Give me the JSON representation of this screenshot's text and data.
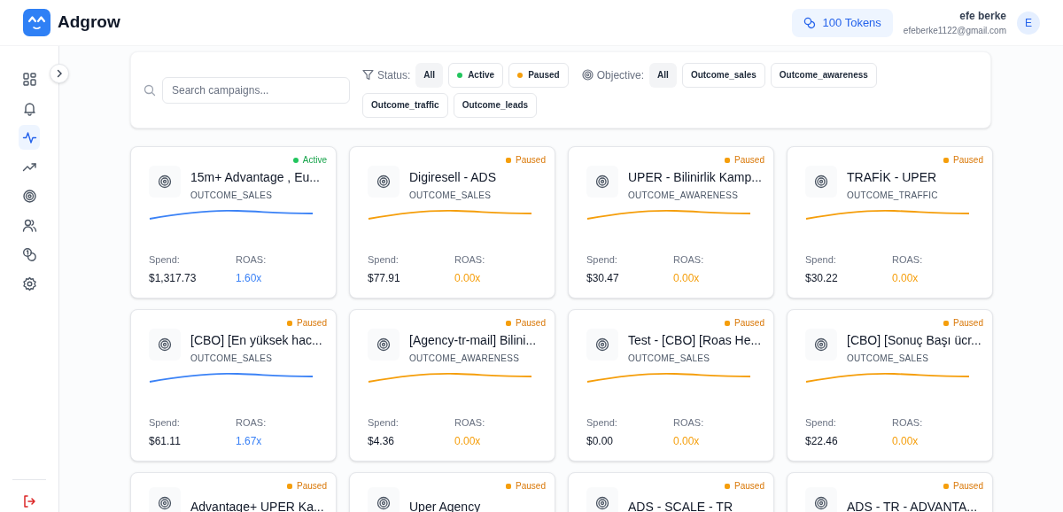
{
  "brand": {
    "name": "Adgrow"
  },
  "header": {
    "tokens": "100 Tokens",
    "user_name": "efe berke",
    "user_email": "efeberke1122@gmail.com",
    "avatar_initial": "E"
  },
  "sidebar": {
    "items": [
      {
        "kind": "dashboard",
        "selected": false
      },
      {
        "kind": "bell",
        "selected": false
      },
      {
        "kind": "activity",
        "selected": true
      },
      {
        "kind": "trending",
        "selected": false
      },
      {
        "kind": "target",
        "selected": false
      },
      {
        "kind": "users",
        "selected": false
      },
      {
        "kind": "coins",
        "selected": false
      },
      {
        "kind": "settings",
        "selected": false
      }
    ]
  },
  "filters": {
    "search_placeholder": "Search campaigns...",
    "status_label": "Status:",
    "status_options": [
      {
        "label": "All",
        "selected": true
      },
      {
        "label": "Active",
        "selected": false,
        "color": "#22c55e"
      },
      {
        "label": "Paused",
        "selected": false,
        "color": "#f59e0b"
      }
    ],
    "objective_label": "Objective:",
    "objective_options": [
      {
        "label": "All",
        "selected": true
      },
      {
        "label": "Outcome_sales",
        "selected": false
      },
      {
        "label": "Outcome_awareness",
        "selected": false
      },
      {
        "label": "Outcome_traffic",
        "selected": false
      },
      {
        "label": "Outcome_leads",
        "selected": false
      }
    ]
  },
  "campaigns": [
    {
      "title": "15m+ Advantage , Eu...",
      "objective": "OUTCOME_SALES",
      "status": "Active",
      "kind": "active",
      "spend_label": "Spend:",
      "spend": "$1,317.73",
      "roas_label": "ROAS:",
      "roas": "1.60x",
      "color": "#3b82f6"
    },
    {
      "title": "Digiresell - ADS",
      "objective": "OUTCOME_SALES",
      "status": "Paused",
      "kind": "paused",
      "spend_label": "Spend:",
      "spend": "$77.91",
      "roas_label": "ROAS:",
      "roas": "0.00x",
      "color": "#f59e0b"
    },
    {
      "title": "UPER - Bilinirlik Kamp...",
      "objective": "OUTCOME_AWARENESS",
      "status": "Paused",
      "kind": "paused",
      "spend_label": "Spend:",
      "spend": "$30.47",
      "roas_label": "ROAS:",
      "roas": "0.00x",
      "color": "#f59e0b"
    },
    {
      "title": "TRAFİK - UPER",
      "objective": "OUTCOME_TRAFFIC",
      "status": "Paused",
      "kind": "paused",
      "spend_label": "Spend:",
      "spend": "$30.22",
      "roas_label": "ROAS:",
      "roas": "0.00x",
      "color": "#f59e0b"
    },
    {
      "title": "[CBO] [En yüksek hac...",
      "objective": "OUTCOME_SALES",
      "status": "Paused",
      "kind": "paused",
      "spend_label": "Spend:",
      "spend": "$61.11",
      "roas_label": "ROAS:",
      "roas": "1.67x",
      "color": "#3b82f6"
    },
    {
      "title": "[Agency-tr-mail] Bilini...",
      "objective": "OUTCOME_AWARENESS",
      "status": "Paused",
      "kind": "paused",
      "spend_label": "Spend:",
      "spend": "$4.36",
      "roas_label": "ROAS:",
      "roas": "0.00x",
      "color": "#f59e0b"
    },
    {
      "title": "Test - [CBO] [Roas He...",
      "objective": "OUTCOME_SALES",
      "status": "Paused",
      "kind": "paused",
      "spend_label": "Spend:",
      "spend": "$0.00",
      "roas_label": "ROAS:",
      "roas": "0.00x",
      "color": "#f59e0b"
    },
    {
      "title": "[CBO] [Sonuç Başı ücr...",
      "objective": "OUTCOME_SALES",
      "status": "Paused",
      "kind": "paused",
      "spend_label": "Spend:",
      "spend": "$22.46",
      "roas_label": "ROAS:",
      "roas": "0.00x",
      "color": "#f59e0b"
    },
    {
      "title": "Advantage+ UPER Ka...",
      "status": "Paused",
      "kind": "paused"
    },
    {
      "title": "Uper Agency",
      "status": "Paused",
      "kind": "paused"
    },
    {
      "title": "ADS - SCALE - TR",
      "status": "Paused",
      "kind": "paused"
    },
    {
      "title": "ADS - TR - ADVANTA...",
      "status": "Paused",
      "kind": "paused"
    }
  ]
}
